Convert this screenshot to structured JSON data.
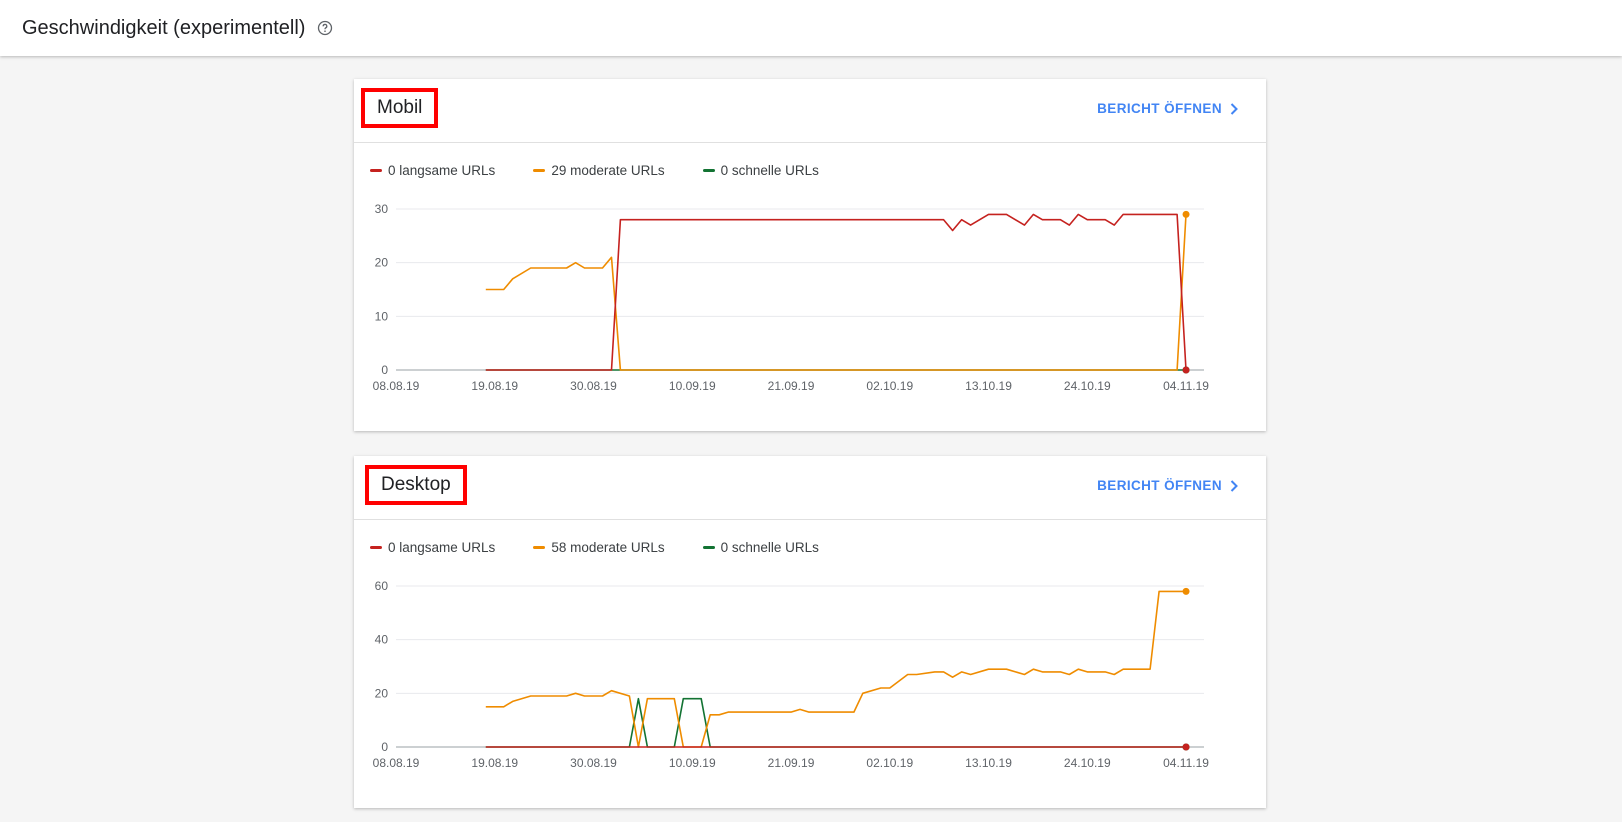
{
  "header": {
    "title": "Geschwindigkeit (experimentell)",
    "help_icon": "help-circle-icon"
  },
  "cards": {
    "mobil": {
      "title": "Mobil",
      "report_link": "BERICHT ÖFFNEN",
      "legend": [
        {
          "label": "0 langsame URLs",
          "color": "#c5221f"
        },
        {
          "label": "29 moderate URLs",
          "color": "#ef8c00"
        },
        {
          "label": "0 schnelle URLs",
          "color": "#137333"
        }
      ]
    },
    "desktop": {
      "title": "Desktop",
      "report_link": "BERICHT ÖFFNEN",
      "legend": [
        {
          "label": "0 langsame URLs",
          "color": "#c5221f"
        },
        {
          "label": "58 moderate URLs",
          "color": "#ef8c00"
        },
        {
          "label": "0 schnelle URLs",
          "color": "#137333"
        }
      ]
    }
  },
  "chart_data": [
    {
      "type": "line",
      "x_ticks": [
        "08.08.19",
        "19.08.19",
        "30.08.19",
        "10.09.19",
        "21.09.19",
        "02.10.19",
        "13.10.19",
        "24.10.19",
        "04.11.19"
      ],
      "y_ticks": [
        "0",
        "10",
        "20",
        "30"
      ],
      "ylim": [
        0,
        30
      ],
      "xlim": [
        "08.08.19",
        "06.11.19"
      ],
      "series": [
        {
          "name": "langsame URLs",
          "color": "#c5221f",
          "points": [
            [
              "18.08.19",
              0
            ],
            [
              "01.09.19",
              0
            ],
            [
              "02.09.19",
              28
            ],
            [
              "15.09.19",
              28
            ],
            [
              "30.09.19",
              28
            ],
            [
              "08.10.19",
              28
            ],
            [
              "09.10.19",
              26
            ],
            [
              "10.10.19",
              28
            ],
            [
              "11.10.19",
              27
            ],
            [
              "13.10.19",
              29
            ],
            [
              "15.10.19",
              29
            ],
            [
              "17.10.19",
              27
            ],
            [
              "18.10.19",
              29
            ],
            [
              "19.10.19",
              28
            ],
            [
              "21.10.19",
              28
            ],
            [
              "22.10.19",
              27
            ],
            [
              "23.10.19",
              29
            ],
            [
              "24.10.19",
              28
            ],
            [
              "26.10.19",
              28
            ],
            [
              "27.10.19",
              27
            ],
            [
              "28.10.19",
              29
            ],
            [
              "03.11.19",
              29
            ],
            [
              "04.11.19",
              0
            ]
          ]
        },
        {
          "name": "moderate URLs",
          "color": "#ef8c00",
          "points": [
            [
              "18.08.19",
              15
            ],
            [
              "20.08.19",
              15
            ],
            [
              "21.08.19",
              17
            ],
            [
              "23.08.19",
              19
            ],
            [
              "27.08.19",
              19
            ],
            [
              "28.08.19",
              20
            ],
            [
              "29.08.19",
              19
            ],
            [
              "31.08.19",
              19
            ],
            [
              "01.09.19",
              21
            ],
            [
              "02.09.19",
              0
            ],
            [
              "15.09.19",
              0
            ],
            [
              "30.09.19",
              0
            ],
            [
              "03.11.19",
              0
            ],
            [
              "04.11.19",
              29
            ]
          ]
        },
        {
          "name": "schnelle URLs",
          "color": "#137333",
          "points": [
            [
              "18.08.19",
              0
            ],
            [
              "04.11.19",
              0
            ]
          ]
        }
      ]
    },
    {
      "type": "line",
      "x_ticks": [
        "08.08.19",
        "19.08.19",
        "30.08.19",
        "10.09.19",
        "21.09.19",
        "02.10.19",
        "13.10.19",
        "24.10.19",
        "04.11.19"
      ],
      "y_ticks": [
        "0",
        "20",
        "40",
        "60"
      ],
      "ylim": [
        0,
        60
      ],
      "xlim": [
        "08.08.19",
        "06.11.19"
      ],
      "series": [
        {
          "name": "langsame URLs",
          "color": "#c5221f",
          "points": [
            [
              "18.08.19",
              0
            ],
            [
              "04.11.19",
              0
            ]
          ]
        },
        {
          "name": "moderate URLs",
          "color": "#ef8c00",
          "points": [
            [
              "18.08.19",
              15
            ],
            [
              "20.08.19",
              15
            ],
            [
              "21.08.19",
              17
            ],
            [
              "23.08.19",
              19
            ],
            [
              "27.08.19",
              19
            ],
            [
              "28.08.19",
              20
            ],
            [
              "29.08.19",
              19
            ],
            [
              "31.08.19",
              19
            ],
            [
              "01.09.19",
              21
            ],
            [
              "03.09.19",
              19
            ],
            [
              "04.09.19",
              0
            ],
            [
              "05.09.19",
              18
            ],
            [
              "08.09.19",
              18
            ],
            [
              "09.09.19",
              0
            ],
            [
              "11.09.19",
              0
            ],
            [
              "12.09.19",
              12
            ],
            [
              "13.09.19",
              12
            ],
            [
              "14.09.19",
              13
            ],
            [
              "21.09.19",
              13
            ],
            [
              "22.09.19",
              14
            ],
            [
              "23.09.19",
              13
            ],
            [
              "28.09.19",
              13
            ],
            [
              "29.09.19",
              20
            ],
            [
              "01.10.19",
              22
            ],
            [
              "02.10.19",
              22
            ],
            [
              "04.10.19",
              27
            ],
            [
              "05.10.19",
              27
            ],
            [
              "07.10.19",
              28
            ],
            [
              "08.10.19",
              28
            ],
            [
              "09.10.19",
              26
            ],
            [
              "10.10.19",
              28
            ],
            [
              "11.10.19",
              27
            ],
            [
              "13.10.19",
              29
            ],
            [
              "15.10.19",
              29
            ],
            [
              "17.10.19",
              27
            ],
            [
              "18.10.19",
              29
            ],
            [
              "19.10.19",
              28
            ],
            [
              "21.10.19",
              28
            ],
            [
              "22.10.19",
              27
            ],
            [
              "23.10.19",
              29
            ],
            [
              "24.10.19",
              28
            ],
            [
              "26.10.19",
              28
            ],
            [
              "27.10.19",
              27
            ],
            [
              "28.10.19",
              29
            ],
            [
              "31.10.19",
              29
            ],
            [
              "01.11.19",
              58
            ],
            [
              "04.11.19",
              58
            ]
          ]
        },
        {
          "name": "schnelle URLs",
          "color": "#137333",
          "points": [
            [
              "18.08.19",
              0
            ],
            [
              "03.09.19",
              0
            ],
            [
              "04.09.19",
              18
            ],
            [
              "05.09.19",
              0
            ],
            [
              "08.09.19",
              0
            ],
            [
              "09.09.19",
              18
            ],
            [
              "11.09.19",
              18
            ],
            [
              "12.09.19",
              0
            ],
            [
              "04.11.19",
              0
            ]
          ]
        }
      ]
    }
  ]
}
